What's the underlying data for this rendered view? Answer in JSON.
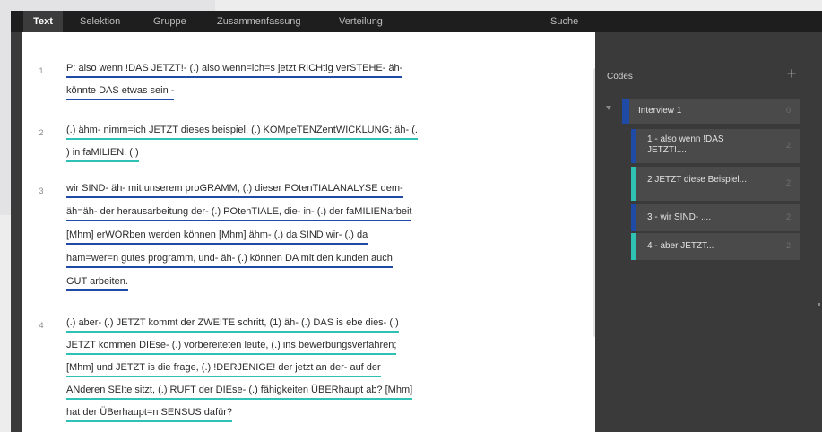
{
  "menu": {
    "items": [
      "Text",
      "Selektion",
      "Gruppe",
      "Zusammenfassung",
      "Verteilung",
      "Suche"
    ],
    "active": "Text"
  },
  "document": {
    "paragraphs": [
      {
        "number": "1",
        "color": "#1f4aa5",
        "lines": [
          "P: also wenn !DAS JETZT!- (.) also wenn=ich=s jetzt RICHtig verSTEHE- äh-",
          "könnte DAS etwas sein -"
        ]
      },
      {
        "number": "2",
        "color": "#2fc1b3",
        "lines": [
          "(.) ähm- nimm=ich JETZT dieses beispiel, (.) KOMpeTENZentWICKLUNG; äh- (.",
          ") in faMILIEN. (.)"
        ]
      },
      {
        "number": "3",
        "color": "#1f4aa5",
        "lines": [
          "wir SIND- äh- mit unserem proGRAMM, (.) dieser POtenTIALANALYSE dem-",
          "äh=äh- der herausarbeitung der- (.) POtenTIALE, die- in- (.) der faMILIENarbeit",
          "[Mhm] erWORben werden können [Mhm] ähm- (.) da SIND wir- (.) da",
          "ham=wer=n gutes programm, und- äh- (.) können DA mit den kunden auch",
          "GUT arbeiten."
        ]
      },
      {
        "number": "4",
        "color": "#2fc1b3",
        "lines": [
          "(.) aber- (.) JETZT kommt der ZWEITE schritt, (1) äh- (.) DAS is ebe dies- (.)",
          "JETZT kommen DIEse- (.) vorbereiteten leute, (.) ins bewerbungsverfahren;",
          "[Mhm] und JETZT is die frage, (.) !DERJENIGE! der jetzt an der- auf der",
          "ANderen SEIte sitzt, (.) RUFT der DIEse- (.) fähigkeiten ÜBERhaupt ab? [Mhm]",
          "hat der ÜBerhaupt=n SENSUS dafür?"
        ]
      }
    ]
  },
  "codes_panel": {
    "title": "Codes",
    "add_icon": "plus-icon",
    "interview": {
      "label": "Interview 1",
      "count": "0",
      "color": "#1f4aa5"
    },
    "items": [
      {
        "label": "1 - also wenn !DAS JETZT!....",
        "count": "2",
        "color": "#1f4aa5"
      },
      {
        "label": "2 JETZT diese Beispiel...",
        "count": "2",
        "color": "#2fc1b3"
      },
      {
        "label": "3 - wir SIND- ....",
        "count": "2",
        "color": "#1f4aa5"
      },
      {
        "label": "4 - aber JETZT...",
        "count": "2",
        "color": "#2fc1b3"
      }
    ]
  }
}
